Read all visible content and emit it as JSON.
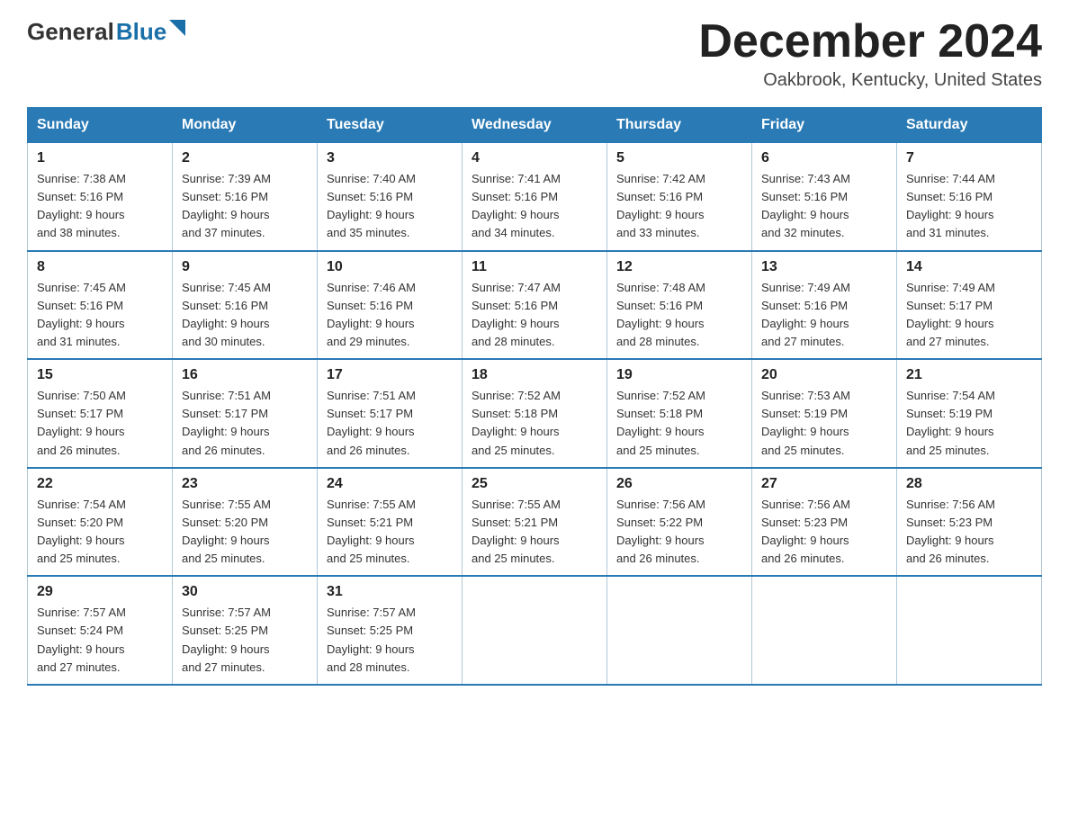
{
  "logo": {
    "general": "General",
    "blue": "Blue"
  },
  "title": "December 2024",
  "location": "Oakbrook, Kentucky, United States",
  "days_of_week": [
    "Sunday",
    "Monday",
    "Tuesday",
    "Wednesday",
    "Thursday",
    "Friday",
    "Saturday"
  ],
  "weeks": [
    [
      {
        "day": "1",
        "sunrise": "7:38 AM",
        "sunset": "5:16 PM",
        "daylight": "9 hours and 38 minutes."
      },
      {
        "day": "2",
        "sunrise": "7:39 AM",
        "sunset": "5:16 PM",
        "daylight": "9 hours and 37 minutes."
      },
      {
        "day": "3",
        "sunrise": "7:40 AM",
        "sunset": "5:16 PM",
        "daylight": "9 hours and 35 minutes."
      },
      {
        "day": "4",
        "sunrise": "7:41 AM",
        "sunset": "5:16 PM",
        "daylight": "9 hours and 34 minutes."
      },
      {
        "day": "5",
        "sunrise": "7:42 AM",
        "sunset": "5:16 PM",
        "daylight": "9 hours and 33 minutes."
      },
      {
        "day": "6",
        "sunrise": "7:43 AM",
        "sunset": "5:16 PM",
        "daylight": "9 hours and 32 minutes."
      },
      {
        "day": "7",
        "sunrise": "7:44 AM",
        "sunset": "5:16 PM",
        "daylight": "9 hours and 31 minutes."
      }
    ],
    [
      {
        "day": "8",
        "sunrise": "7:45 AM",
        "sunset": "5:16 PM",
        "daylight": "9 hours and 31 minutes."
      },
      {
        "day": "9",
        "sunrise": "7:45 AM",
        "sunset": "5:16 PM",
        "daylight": "9 hours and 30 minutes."
      },
      {
        "day": "10",
        "sunrise": "7:46 AM",
        "sunset": "5:16 PM",
        "daylight": "9 hours and 29 minutes."
      },
      {
        "day": "11",
        "sunrise": "7:47 AM",
        "sunset": "5:16 PM",
        "daylight": "9 hours and 28 minutes."
      },
      {
        "day": "12",
        "sunrise": "7:48 AM",
        "sunset": "5:16 PM",
        "daylight": "9 hours and 28 minutes."
      },
      {
        "day": "13",
        "sunrise": "7:49 AM",
        "sunset": "5:16 PM",
        "daylight": "9 hours and 27 minutes."
      },
      {
        "day": "14",
        "sunrise": "7:49 AM",
        "sunset": "5:17 PM",
        "daylight": "9 hours and 27 minutes."
      }
    ],
    [
      {
        "day": "15",
        "sunrise": "7:50 AM",
        "sunset": "5:17 PM",
        "daylight": "9 hours and 26 minutes."
      },
      {
        "day": "16",
        "sunrise": "7:51 AM",
        "sunset": "5:17 PM",
        "daylight": "9 hours and 26 minutes."
      },
      {
        "day": "17",
        "sunrise": "7:51 AM",
        "sunset": "5:17 PM",
        "daylight": "9 hours and 26 minutes."
      },
      {
        "day": "18",
        "sunrise": "7:52 AM",
        "sunset": "5:18 PM",
        "daylight": "9 hours and 25 minutes."
      },
      {
        "day": "19",
        "sunrise": "7:52 AM",
        "sunset": "5:18 PM",
        "daylight": "9 hours and 25 minutes."
      },
      {
        "day": "20",
        "sunrise": "7:53 AM",
        "sunset": "5:19 PM",
        "daylight": "9 hours and 25 minutes."
      },
      {
        "day": "21",
        "sunrise": "7:54 AM",
        "sunset": "5:19 PM",
        "daylight": "9 hours and 25 minutes."
      }
    ],
    [
      {
        "day": "22",
        "sunrise": "7:54 AM",
        "sunset": "5:20 PM",
        "daylight": "9 hours and 25 minutes."
      },
      {
        "day": "23",
        "sunrise": "7:55 AM",
        "sunset": "5:20 PM",
        "daylight": "9 hours and 25 minutes."
      },
      {
        "day": "24",
        "sunrise": "7:55 AM",
        "sunset": "5:21 PM",
        "daylight": "9 hours and 25 minutes."
      },
      {
        "day": "25",
        "sunrise": "7:55 AM",
        "sunset": "5:21 PM",
        "daylight": "9 hours and 25 minutes."
      },
      {
        "day": "26",
        "sunrise": "7:56 AM",
        "sunset": "5:22 PM",
        "daylight": "9 hours and 26 minutes."
      },
      {
        "day": "27",
        "sunrise": "7:56 AM",
        "sunset": "5:23 PM",
        "daylight": "9 hours and 26 minutes."
      },
      {
        "day": "28",
        "sunrise": "7:56 AM",
        "sunset": "5:23 PM",
        "daylight": "9 hours and 26 minutes."
      }
    ],
    [
      {
        "day": "29",
        "sunrise": "7:57 AM",
        "sunset": "5:24 PM",
        "daylight": "9 hours and 27 minutes."
      },
      {
        "day": "30",
        "sunrise": "7:57 AM",
        "sunset": "5:25 PM",
        "daylight": "9 hours and 27 minutes."
      },
      {
        "day": "31",
        "sunrise": "7:57 AM",
        "sunset": "5:25 PM",
        "daylight": "9 hours and 28 minutes."
      },
      null,
      null,
      null,
      null
    ]
  ]
}
